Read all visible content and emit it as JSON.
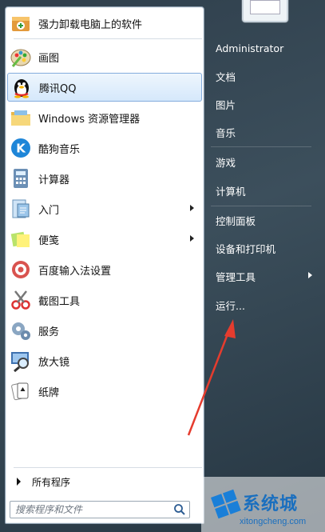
{
  "programs": [
    {
      "label": "强力卸载电脑上的软件",
      "icon": "uninstall-box-icon",
      "submenu": false
    },
    {
      "label": "画图",
      "icon": "paint-palette-icon",
      "submenu": false
    },
    {
      "label": "腾讯QQ",
      "icon": "qq-penguin-icon",
      "submenu": false,
      "selected": true
    },
    {
      "label": "Windows 资源管理器",
      "icon": "explorer-folder-icon",
      "submenu": false
    },
    {
      "label": "酷狗音乐",
      "icon": "kugou-k-icon",
      "submenu": false
    },
    {
      "label": "计算器",
      "icon": "calculator-icon",
      "submenu": false
    },
    {
      "label": "入门",
      "icon": "getting-started-icon",
      "submenu": true
    },
    {
      "label": "便笺",
      "icon": "sticky-notes-icon",
      "submenu": true
    },
    {
      "label": "百度输入法设置",
      "icon": "settings-gear-icon",
      "submenu": false
    },
    {
      "label": "截图工具",
      "icon": "snipping-scissors-icon",
      "submenu": false
    },
    {
      "label": "服务",
      "icon": "services-gears-icon",
      "submenu": false
    },
    {
      "label": "放大镜",
      "icon": "magnifier-icon",
      "submenu": false
    },
    {
      "label": "纸牌",
      "icon": "solitaire-cards-icon",
      "submenu": false
    }
  ],
  "all_programs": "所有程序",
  "search": {
    "placeholder": "搜索程序和文件"
  },
  "right": [
    {
      "label": "Administrator",
      "submenu": false
    },
    {
      "label": "文档",
      "submenu": false
    },
    {
      "label": "图片",
      "submenu": false
    },
    {
      "label": "音乐",
      "submenu": false
    },
    {
      "label": "游戏",
      "submenu": false
    },
    {
      "label": "计算机",
      "submenu": false
    },
    {
      "label": "控制面板",
      "submenu": false
    },
    {
      "label": "设备和打印机",
      "submenu": false
    },
    {
      "label": "管理工具",
      "submenu": true
    },
    {
      "label": "运行...",
      "submenu": false
    }
  ],
  "watermark": {
    "title": "系统城",
    "url": "xitongcheng.com"
  },
  "colors": {
    "selection": "#d5e8fb",
    "annotation_arrow": "#e53c2e",
    "brand": "#1a6fbf"
  }
}
